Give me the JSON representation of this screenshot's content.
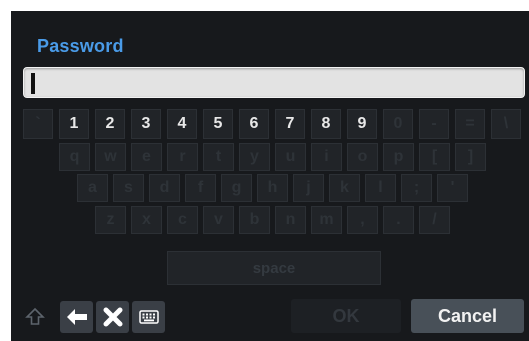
{
  "dialog": {
    "title": "Password",
    "input": {
      "value": ""
    }
  },
  "keyboard": {
    "row1": [
      "`",
      "1",
      "2",
      "3",
      "4",
      "5",
      "6",
      "7",
      "8",
      "9",
      "0",
      "-",
      "=",
      "\\"
    ],
    "row1_enabled": [
      false,
      true,
      true,
      true,
      true,
      true,
      true,
      true,
      true,
      true,
      false,
      false,
      false,
      false
    ],
    "row2": [
      "q",
      "w",
      "e",
      "r",
      "t",
      "y",
      "u",
      "i",
      "o",
      "p",
      "[",
      "]"
    ],
    "row3": [
      "a",
      "s",
      "d",
      "f",
      "g",
      "h",
      "j",
      "k",
      "l",
      ";",
      "'"
    ],
    "row4": [
      "z",
      "x",
      "c",
      "v",
      "b",
      "n",
      "m",
      ",",
      ".",
      "/"
    ],
    "space_label": "space"
  },
  "toolbar": {
    "ok_label": "OK",
    "cancel_label": "Cancel",
    "icons": [
      "shift-up-arrow-icon",
      "backspace-arrow-icon",
      "clear-x-icon",
      "keyboard-icon"
    ]
  },
  "colors": {
    "title": "#4a9be8",
    "background": "#17191c",
    "key_text_active": "#e8e8e8"
  }
}
